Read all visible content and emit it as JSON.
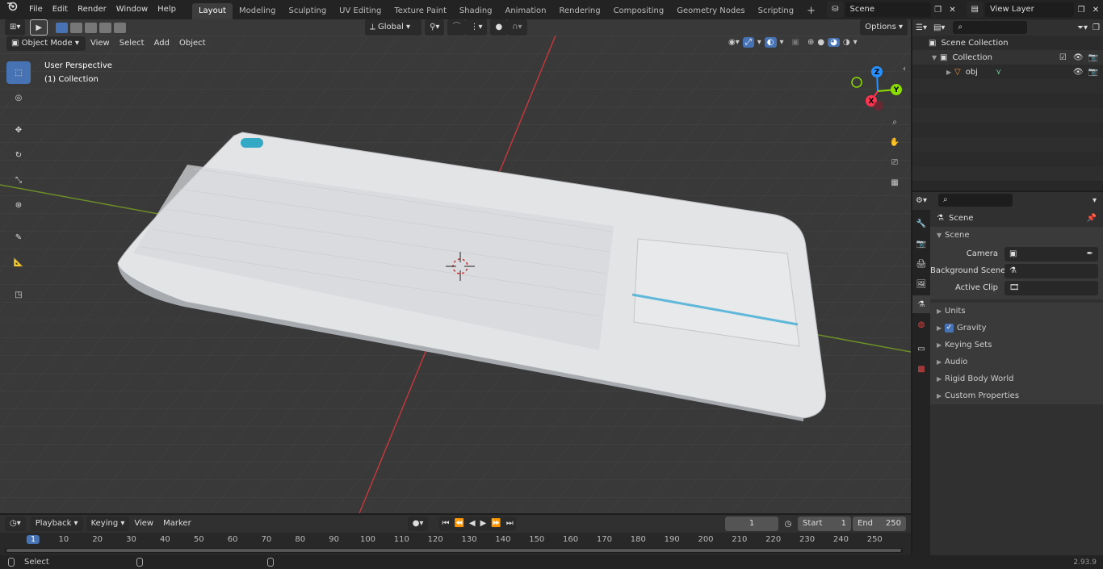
{
  "topbar": {
    "menus": [
      "File",
      "Edit",
      "Render",
      "Window",
      "Help"
    ],
    "workspaces": [
      "Layout",
      "Modeling",
      "Sculpting",
      "UV Editing",
      "Texture Paint",
      "Shading",
      "Animation",
      "Rendering",
      "Compositing",
      "Geometry Nodes",
      "Scripting"
    ],
    "active_workspace": "Layout",
    "scene_name": "Scene",
    "view_layer": "View Layer"
  },
  "viewport_header": {
    "mode": "Object Mode",
    "menus": [
      "View",
      "Select",
      "Add",
      "Object"
    ],
    "transform_orientation": "Global",
    "options": "Options"
  },
  "viewport": {
    "overlay_title": "User Perspective",
    "overlay_sub": "(1) Collection",
    "gizmo": {
      "x": "X",
      "y": "Y",
      "z": "Z"
    }
  },
  "outliner": {
    "root": "Scene Collection",
    "collection": "Collection",
    "object": "obj"
  },
  "properties": {
    "context": "Scene",
    "panel": "Scene",
    "fields": [
      {
        "label": "Camera",
        "value": ""
      },
      {
        "label": "Background Scene",
        "value": ""
      },
      {
        "label": "Active Clip",
        "value": ""
      }
    ],
    "subpanels": [
      "Units",
      "Gravity",
      "Keying Sets",
      "Audio",
      "Rigid Body World",
      "Custom Properties"
    ]
  },
  "timeline": {
    "menus": [
      "Playback",
      "Keying",
      "View",
      "Marker"
    ],
    "current_frame": "1",
    "start_label": "Start",
    "start": "1",
    "end_label": "End",
    "end": "250",
    "ticks": [
      "1",
      "10",
      "20",
      "30",
      "40",
      "50",
      "60",
      "70",
      "80",
      "90",
      "100",
      "110",
      "120",
      "130",
      "140",
      "150",
      "160",
      "170",
      "180",
      "190",
      "200",
      "210",
      "220",
      "230",
      "240",
      "250"
    ]
  },
  "statusbar": {
    "action": "Select",
    "version": "2.93.9"
  },
  "colors": {
    "accent": "#4772b3",
    "x_axis": "#ff3352",
    "y_axis": "#8bdc00",
    "z_axis": "#2890ff"
  }
}
